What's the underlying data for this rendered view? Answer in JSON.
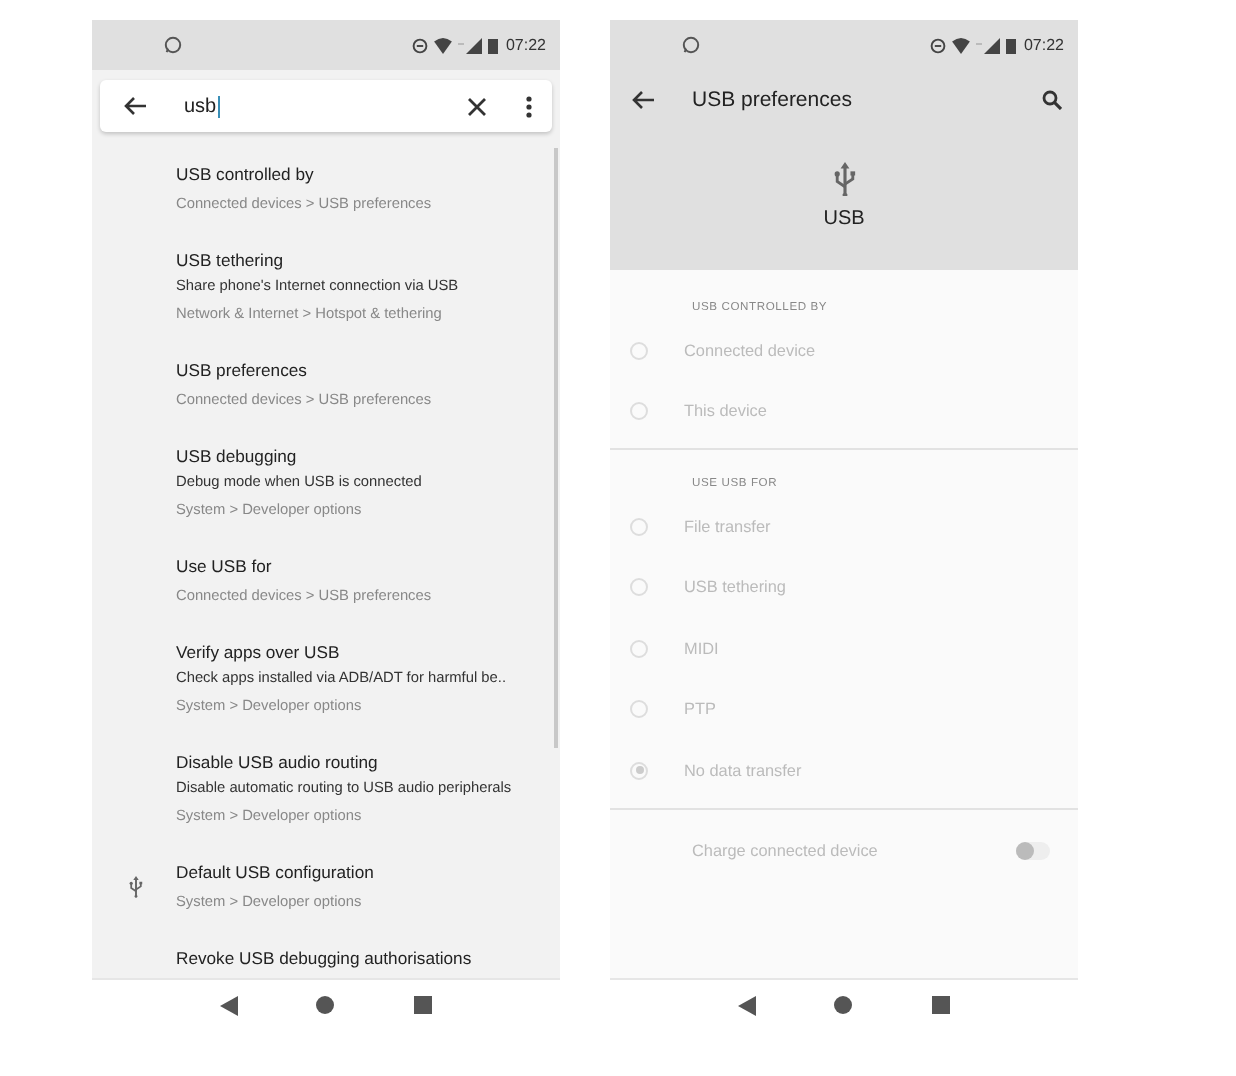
{
  "left_phone": {
    "status_bar": {
      "time": "07:22"
    },
    "search": {
      "value": "usb"
    },
    "results": [
      {
        "kind": "plain",
        "title": "USB controlled by",
        "path": "Connected devices > USB preferences"
      },
      {
        "kind": "plain",
        "title": "USB tethering",
        "summary": "Share phone's Internet connection via USB",
        "path": "Network & Internet > Hotspot & tethering"
      },
      {
        "kind": "plain",
        "title": "USB preferences",
        "path": "Connected devices > USB preferences"
      },
      {
        "kind": "plain",
        "title": "USB debugging",
        "summary": "Debug mode when USB is connected",
        "path": "System > Developer options"
      },
      {
        "kind": "plain",
        "title": "Use USB for",
        "path": "Connected devices > USB preferences"
      },
      {
        "kind": "plain",
        "title": "Verify apps over USB",
        "summary": "Check apps installed via ADB/ADT for harmful be..",
        "path": "System > Developer options"
      },
      {
        "kind": "plain",
        "title": "Disable USB audio routing",
        "summary": "Disable automatic routing to USB audio peripherals",
        "path": "System > Developer options"
      },
      {
        "kind": "with-icon",
        "title": "Default USB configuration",
        "path": "System > Developer options"
      },
      {
        "kind": "plain",
        "title": "Revoke USB debugging authorisations"
      }
    ]
  },
  "right_phone": {
    "status_bar": {
      "time": "07:22"
    },
    "toolbar": {
      "title": "USB preferences"
    },
    "header": {
      "label": "USB"
    },
    "sections": [
      {
        "heading": "USB CONTROLLED BY",
        "options": [
          {
            "label": "Connected device",
            "selected": false,
            "disabled": true
          },
          {
            "label": "This device",
            "selected": false,
            "disabled": true
          }
        ]
      },
      {
        "heading": "USE USB FOR",
        "options": [
          {
            "label": "File transfer",
            "selected": false,
            "disabled": true
          },
          {
            "label": "USB tethering",
            "selected": false,
            "disabled": true
          },
          {
            "label": "MIDI",
            "selected": false,
            "disabled": true
          },
          {
            "label": "PTP",
            "selected": false,
            "disabled": true
          },
          {
            "label": "No data transfer",
            "selected": true,
            "disabled": true
          }
        ]
      }
    ],
    "toggle": {
      "label": "Charge connected device",
      "on": false,
      "disabled": true
    }
  }
}
